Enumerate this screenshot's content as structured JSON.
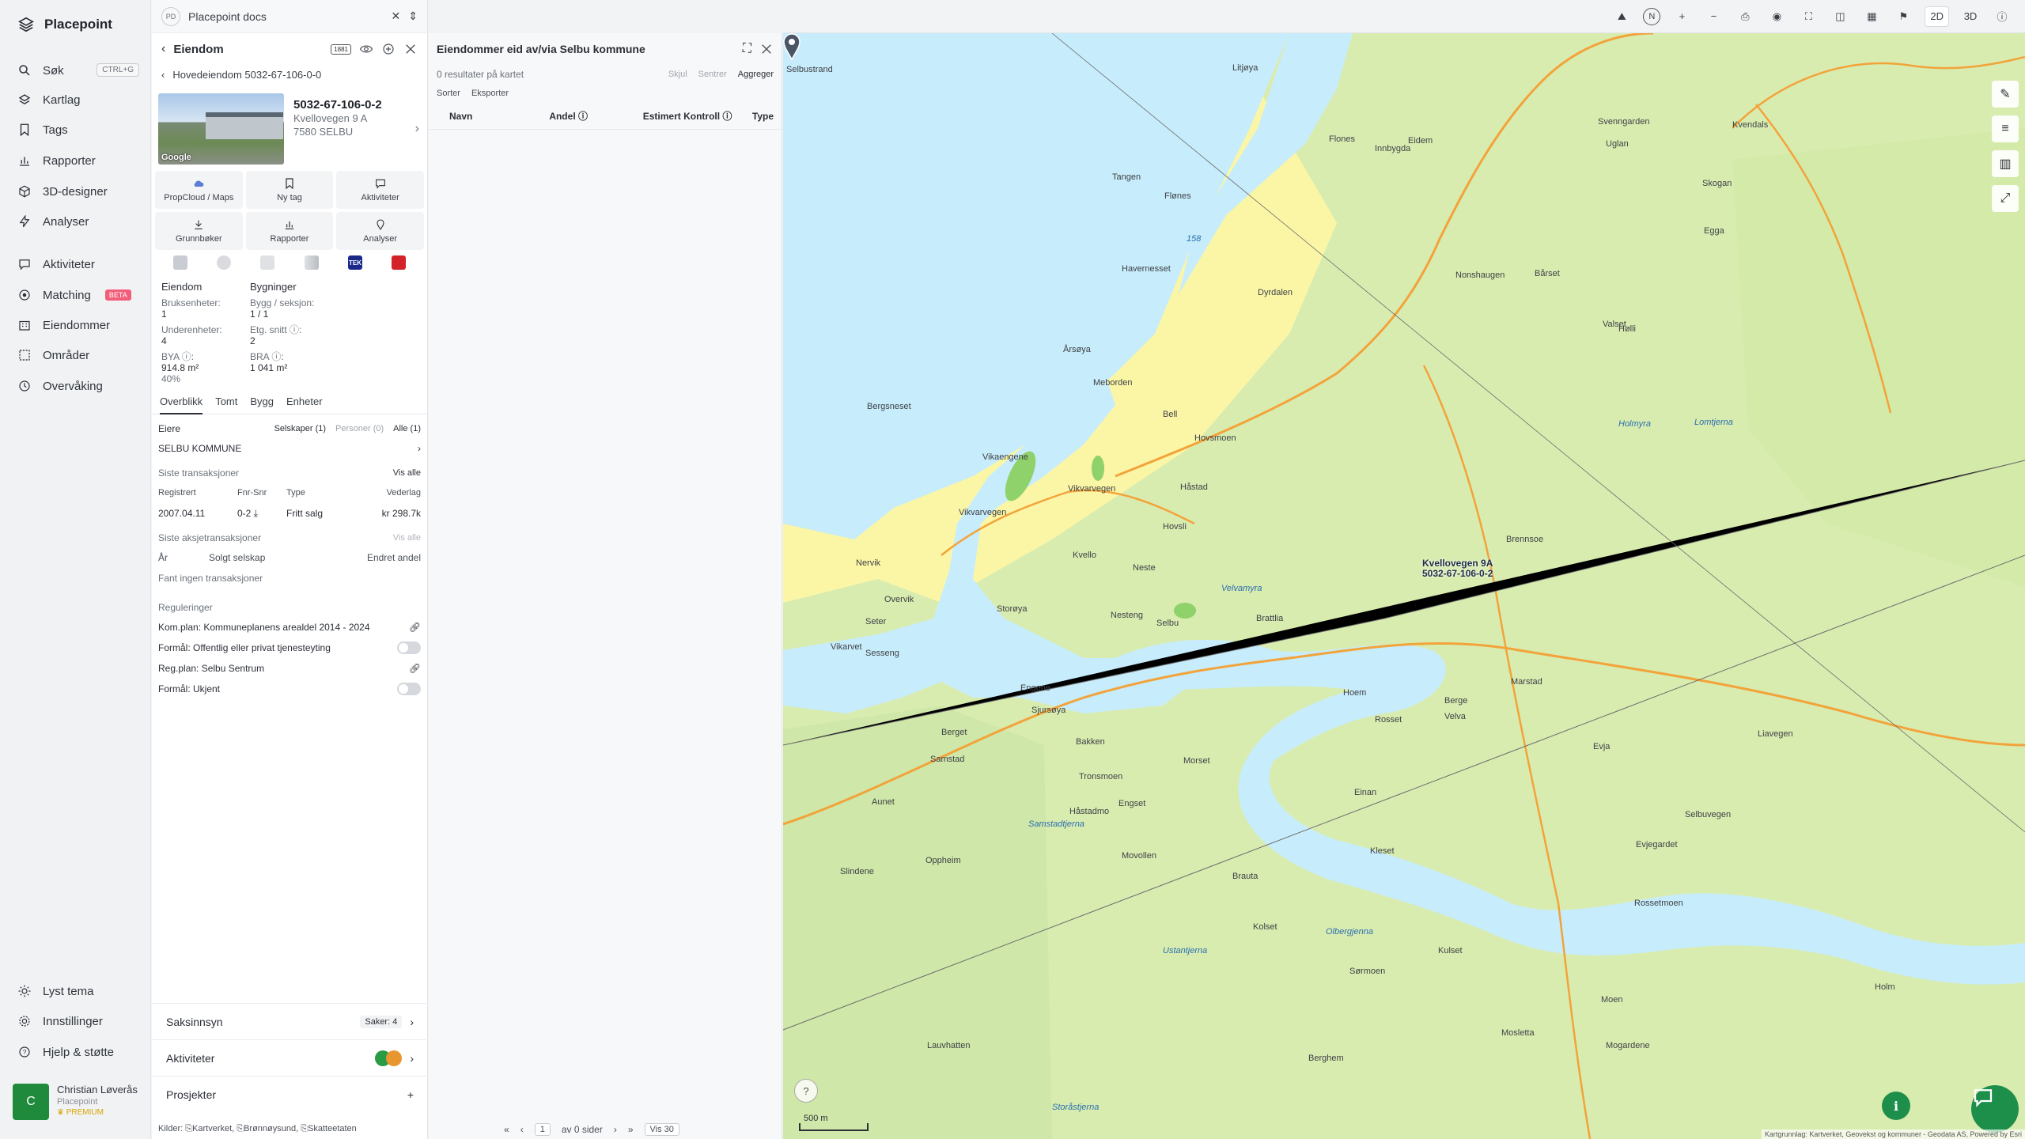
{
  "app": {
    "name": "Placepoint"
  },
  "nav": {
    "search": "Søk",
    "search_kbd": "CTRL+G",
    "items": [
      "Kartlag",
      "Tags",
      "Rapporter",
      "3D-designer",
      "Analyser"
    ],
    "items2": [
      "Aktiviteter",
      "Matching",
      "Eiendommer",
      "Områder",
      "Overvåking"
    ],
    "beta": "BETA",
    "bottom": [
      "Lyst tema",
      "Innstillinger",
      "Hjelp & støtte"
    ],
    "user": {
      "initial": "C",
      "name": "Christian Løverås",
      "org": "Placepoint",
      "tier": "PREMIUM"
    }
  },
  "docs": {
    "badge": "PD",
    "title": "Placepoint docs"
  },
  "panel": {
    "title": "Eiendom",
    "badge": "1881",
    "breadcrumb": "Hovedeiendom 5032-67-106-0-0",
    "property": {
      "id": "5032-67-106-0-2",
      "street": "Kvellovegen 9 A",
      "postal": "7580 SELBU",
      "photo_credit": "Google"
    },
    "buttons": [
      "PropCloud / Maps",
      "Ny tag",
      "Aktiviteter",
      "Grunnbøker",
      "Rapporter",
      "Analyser"
    ],
    "ext_tek": "TEK",
    "facts_header": [
      "Eiendom",
      "Bygninger"
    ],
    "facts": [
      {
        "l1": "Bruksenheter:",
        "v1": "1",
        "l2": "Bygg / seksjon:",
        "v2": "1 / 1"
      },
      {
        "l1": "Underenheter:",
        "v1": "4",
        "l2": "Etg. snitt ⓘ:",
        "v2": "2"
      },
      {
        "l1": "BYA ⓘ:",
        "v1": "914.8 m²",
        "l2": "BRA ⓘ:",
        "v2": "1 041 m²"
      }
    ],
    "bya_pct": "40%",
    "tabs": [
      "Overblikk",
      "Tomt",
      "Bygg",
      "Enheter"
    ],
    "owners": {
      "label": "Eiere",
      "companies": "Selskaper (1)",
      "persons": "Personer (0)",
      "all": "Alle (1)",
      "name": "SELBU KOMMUNE"
    },
    "transactions": {
      "label": "Siste transaksjoner",
      "view_all": "Vis alle",
      "headers": [
        "Registrert",
        "Fnr-Snr",
        "Type",
        "Vederlag"
      ],
      "row": [
        "2007.04.11",
        "0-2 ⤓",
        "Fritt salg",
        "kr 298.7k"
      ]
    },
    "share_tx": {
      "label": "Siste aksjetransaksjoner",
      "view_all": "Vis alle",
      "headers": [
        "År",
        "Solgt selskap",
        "Endret andel"
      ],
      "empty": "Fant ingen transaksjoner"
    },
    "regs": {
      "label": "Reguleringer",
      "items": [
        "Kom.plan: Kommuneplanens arealdel 2014 - 2024",
        "Formål: Offentlig eller privat tjenesteyting",
        "Reg.plan: Selbu Sentrum",
        "Formål: Ukjent"
      ]
    },
    "saksinnsyn": {
      "label": "Saksinnsyn",
      "count": "Saker: 4"
    },
    "aktiviteter": "Aktiviteter",
    "prosjekter": "Prosjekter",
    "sources": "Kilder: ⎘Kartverket, ⎘Brønnøysund, ⎘Skatteetaten"
  },
  "results": {
    "title": "Eiendommer eid av/via Selbu kommune",
    "count": "0 resultater på kartet",
    "hide": "Skjul",
    "center": "Sentrer",
    "aggregate": "Aggreger",
    "sort": "Sorter",
    "export": "Eksporter",
    "columns": [
      "Navn",
      "Andel ⓘ",
      "Estimert Kontroll ⓘ",
      "Type"
    ],
    "pager": {
      "page": "1",
      "of": "av 0 sider",
      "per": "Vis 30"
    }
  },
  "map": {
    "mode2d": "2D",
    "mode3d": "3D",
    "compass": "N",
    "scale": "500 m",
    "marker_label": [
      "Kvellovegen 9A",
      "5032-67-106-0-2"
    ],
    "labels": [
      {
        "t": "Selbustrand"
      },
      {
        "t": "Litjøya"
      },
      {
        "t": "Flones"
      },
      {
        "t": "Eidem"
      },
      {
        "t": "Tangen"
      },
      {
        "t": "Flønes"
      },
      {
        "t": "Innbygda"
      },
      {
        "t": "Havernesset"
      },
      {
        "t": "Nonshaugen"
      },
      {
        "t": "Bårset"
      },
      {
        "t": "Årsøya"
      },
      {
        "t": "Meborden"
      },
      {
        "t": "Bergsneset"
      },
      {
        "t": "Vikaengene"
      },
      {
        "t": "Hovsmoen"
      },
      {
        "t": "Håstad"
      },
      {
        "t": "Kvello"
      },
      {
        "t": "Neste"
      },
      {
        "t": "Storøya"
      },
      {
        "t": "Nervik"
      },
      {
        "t": "Overvik"
      },
      {
        "t": "Seter"
      },
      {
        "t": "Sesseng"
      },
      {
        "t": "Engene"
      },
      {
        "t": "Sjursøya"
      },
      {
        "t": "Berget"
      },
      {
        "t": "Bakken"
      },
      {
        "t": "Morset"
      },
      {
        "t": "Samstad"
      },
      {
        "t": "Aunet"
      },
      {
        "t": "Tronsmoen"
      },
      {
        "t": "Håstadmo"
      },
      {
        "t": "Engset"
      },
      {
        "t": "Kleset"
      },
      {
        "t": "Brauta"
      },
      {
        "t": "Kolset"
      },
      {
        "t": "Movollen"
      },
      {
        "t": "Oppheim"
      },
      {
        "t": "Slindene"
      },
      {
        "t": "Lauvhatten"
      },
      {
        "t": "Berghem"
      },
      {
        "t": "Mosletta"
      },
      {
        "t": "Mogardene"
      },
      {
        "t": "Selbuvegen"
      },
      {
        "t": "Evjegardet"
      },
      {
        "t": "Rosset"
      },
      {
        "t": "Velva"
      },
      {
        "t": "Evja"
      },
      {
        "t": "Liavegen"
      },
      {
        "t": "Rossetmoen"
      },
      {
        "t": "Marstad"
      },
      {
        "t": "Hoem"
      },
      {
        "t": "Berge"
      },
      {
        "t": "Einan"
      },
      {
        "t": "Vikvarvegen"
      },
      {
        "t": "Vikvarvegen"
      },
      {
        "t": "Kulset"
      },
      {
        "t": "Sørmoen"
      },
      {
        "t": "Moen"
      },
      {
        "t": "Holm"
      },
      {
        "t": "Brennsoe"
      },
      {
        "t": "Skogan"
      },
      {
        "t": "Egga"
      },
      {
        "t": "Kvendals"
      },
      {
        "t": "Svenngarden"
      },
      {
        "t": "Uglan"
      },
      {
        "t": "Hølli"
      },
      {
        "t": "Valset"
      },
      {
        "t": "Dyrdalen"
      },
      {
        "t": "Hovsli"
      },
      {
        "t": "Brattlia"
      },
      {
        "t": "Selbu"
      },
      {
        "t": "Nesteng"
      },
      {
        "t": "Vikarvet"
      },
      {
        "t": "Bell"
      }
    ],
    "water_labels": [
      "Samstadtjerna",
      "Storåstjerna",
      "Ustantjerna",
      "Olbergjenna",
      "Velvamyra",
      "Holmyra",
      "Lomtjerna",
      "158"
    ],
    "attribution": "Kartgrunnlag: Kartverket, Geovekst og kommuner - Geodata AS, Powered by Esri"
  }
}
